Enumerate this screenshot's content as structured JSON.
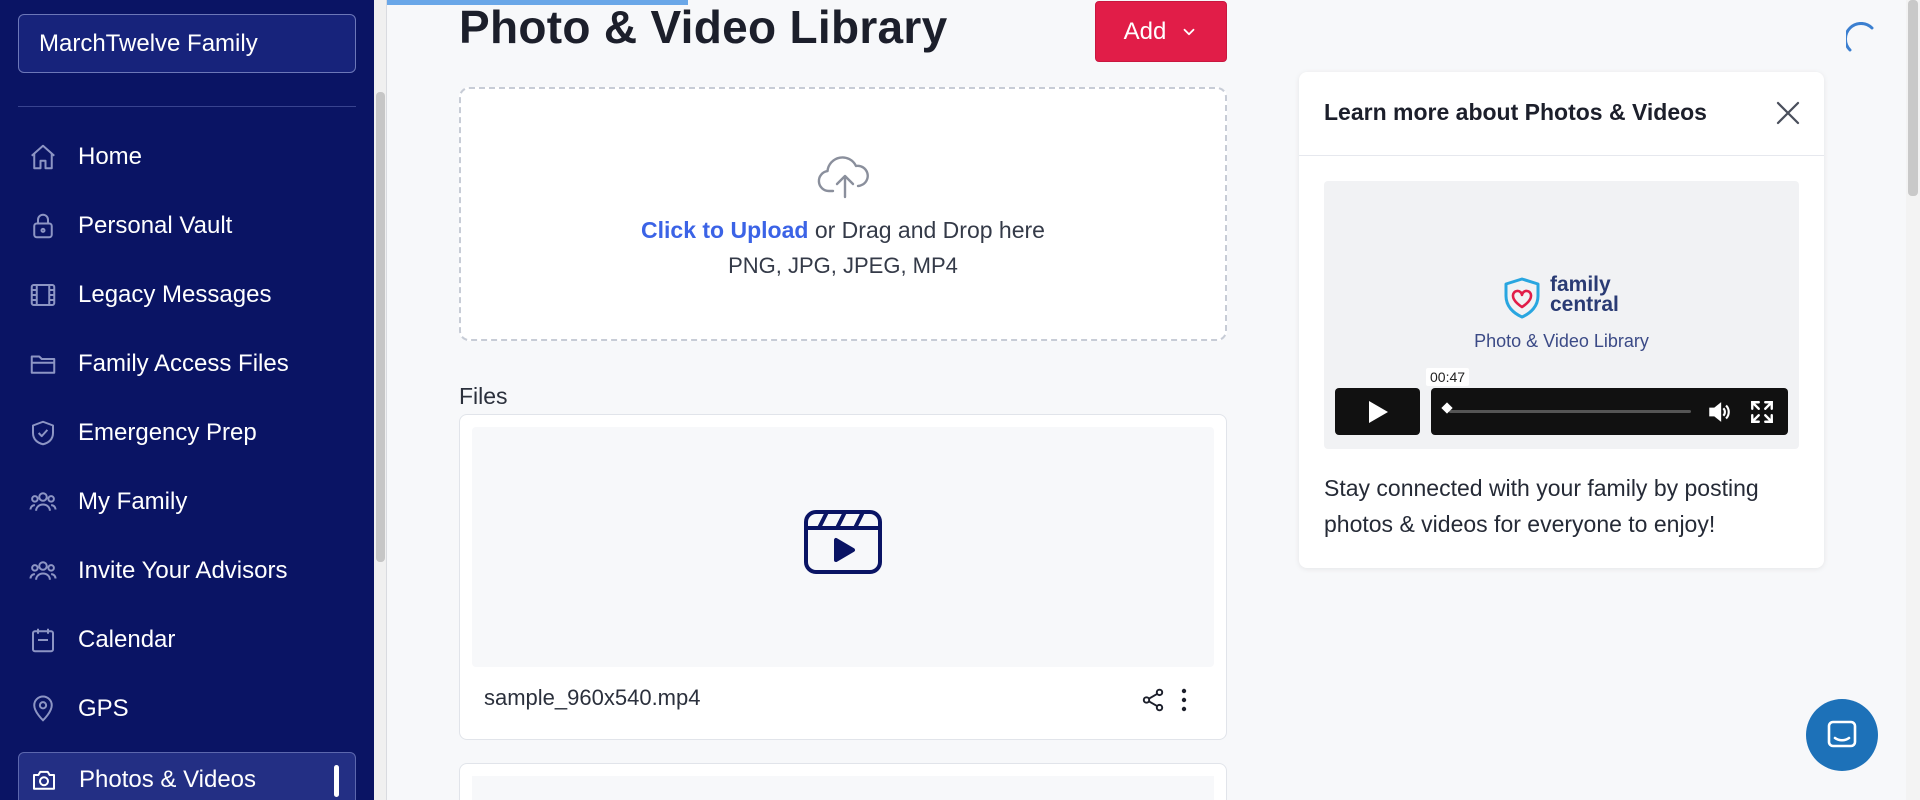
{
  "sidebar": {
    "family_name": "MarchTwelve Family",
    "items": [
      {
        "label": "Home",
        "icon": "home-icon"
      },
      {
        "label": "Personal Vault",
        "icon": "lock-icon"
      },
      {
        "label": "Legacy Messages",
        "icon": "film-icon"
      },
      {
        "label": "Family Access Files",
        "icon": "folder-icon"
      },
      {
        "label": "Emergency Prep",
        "icon": "shield-check-icon"
      },
      {
        "label": "My Family",
        "icon": "users-icon"
      },
      {
        "label": "Invite Your Advisors",
        "icon": "users-icon"
      },
      {
        "label": "Calendar",
        "icon": "calendar-icon"
      },
      {
        "label": "GPS",
        "icon": "map-pin-icon"
      },
      {
        "label": "Photos & Videos",
        "icon": "camera-icon",
        "active": true
      }
    ]
  },
  "header": {
    "title": "Photo & Video Library",
    "add_label": "Add"
  },
  "upload": {
    "link_text": "Click to Upload",
    "rest_text": " or Drag and Drop here",
    "formats": "PNG, JPG, JPEG, MP4"
  },
  "files": {
    "label": "Files",
    "items": [
      {
        "name": "sample_960x540.mp4"
      }
    ]
  },
  "learn_panel": {
    "title": "Learn more about Photos & Videos",
    "brand_line1": "family",
    "brand_line2": "central",
    "video_subtitle": "Photo & Video Library",
    "time": "00:47",
    "description": "Stay connected with your family by posting photos & videos for everyone to enjoy!"
  },
  "colors": {
    "sidebar_bg": "#0a1464",
    "accent_red": "#e11d48",
    "link_blue": "#3b63e6",
    "chat_blue": "#1d71b8"
  }
}
